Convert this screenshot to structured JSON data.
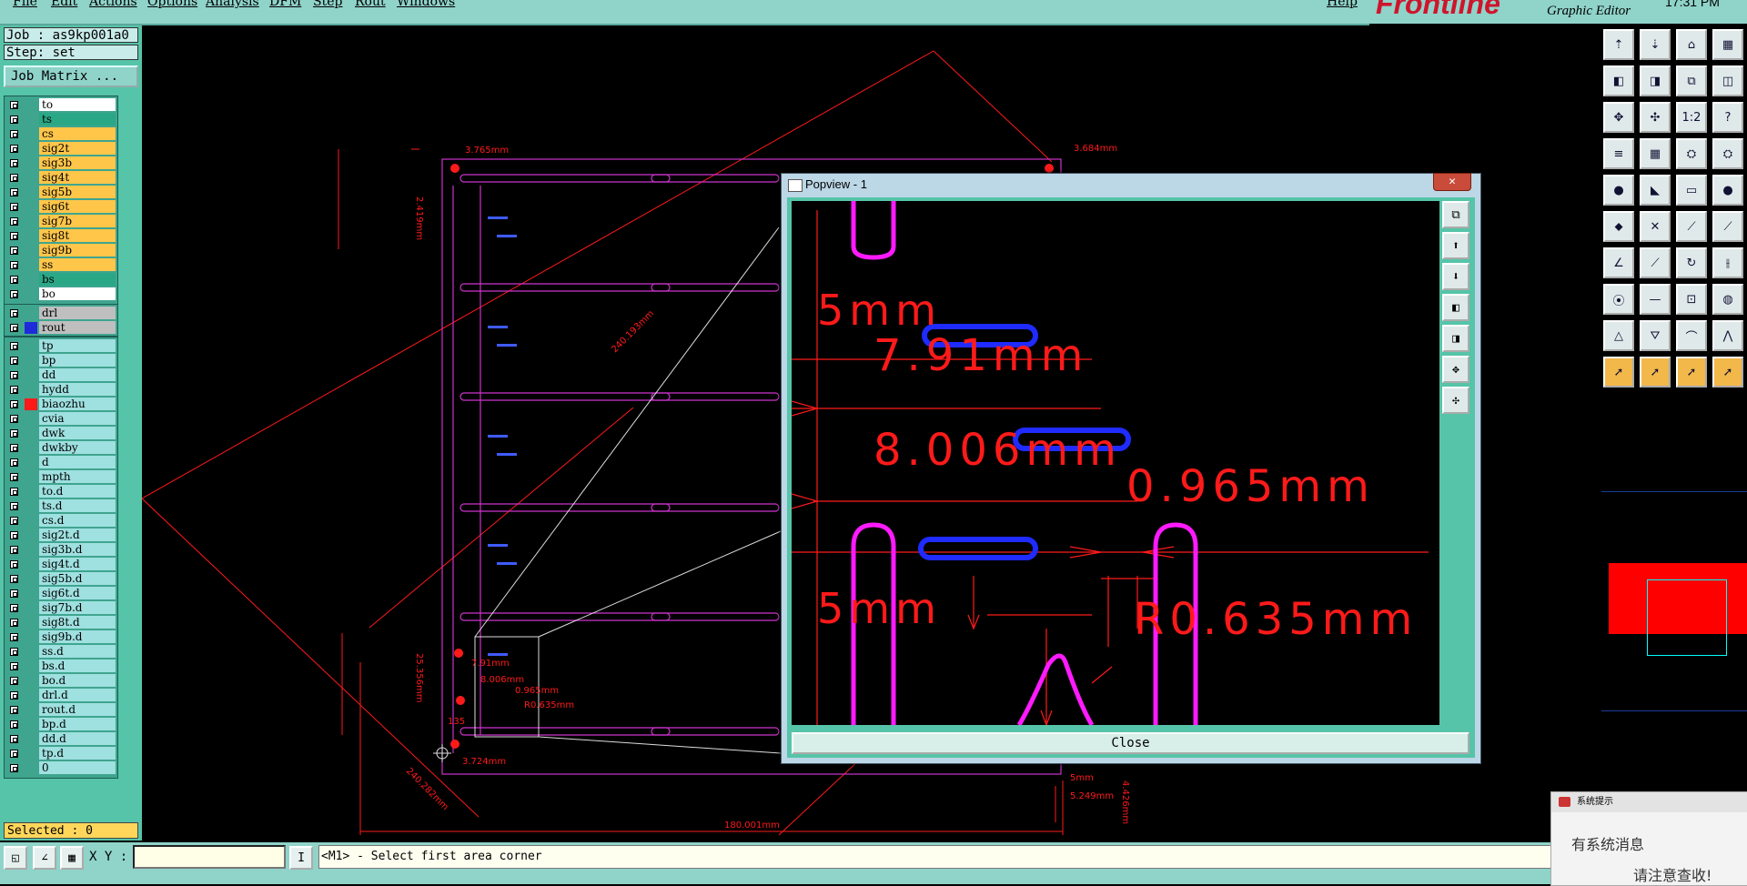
{
  "menu": {
    "items": [
      "File",
      "Edit",
      "Actions",
      "Options",
      "Analysis",
      "DFM",
      "Step",
      "Rout",
      "Windows"
    ],
    "help": "Help"
  },
  "brand": {
    "name": "Frontline",
    "subtitle": "Graphic Editor",
    "time": "17:31 PM"
  },
  "job": {
    "label": "Job : as9kp001a0",
    "step": "Step: set",
    "matrix_button": "Job Matrix ..."
  },
  "layers": {
    "group1": [
      {
        "name": "to",
        "color": "#ffffff"
      },
      {
        "name": "ts",
        "color": "#2aa886"
      },
      {
        "name": "cs",
        "color": "#ffc64a"
      },
      {
        "name": "sig2t",
        "color": "#ffc64a"
      },
      {
        "name": "sig3b",
        "color": "#ffc64a"
      },
      {
        "name": "sig4t",
        "color": "#ffc64a"
      },
      {
        "name": "sig5b",
        "color": "#ffc64a"
      },
      {
        "name": "sig6t",
        "color": "#ffc64a"
      },
      {
        "name": "sig7b",
        "color": "#ffc64a"
      },
      {
        "name": "sig8t",
        "color": "#ffc64a"
      },
      {
        "name": "sig9b",
        "color": "#ffc64a"
      },
      {
        "name": "ss",
        "color": "#ffc64a"
      },
      {
        "name": "bs",
        "color": "#2aa886"
      },
      {
        "name": "bo",
        "color": "#ffffff"
      }
    ],
    "group2": [
      {
        "name": "drl",
        "color": "#bfbfbf"
      },
      {
        "name": "rout",
        "color": "#bfbfbf",
        "swatch": "#1f2bd8"
      }
    ],
    "group3": [
      {
        "name": "tp"
      },
      {
        "name": "bp"
      },
      {
        "name": "dd"
      },
      {
        "name": "hydd"
      },
      {
        "name": "biaozhu",
        "swatch": "#ff1a1a",
        "mark": "■"
      },
      {
        "name": "cvia"
      },
      {
        "name": "dwk"
      },
      {
        "name": "dwkby"
      },
      {
        "name": "d"
      },
      {
        "name": "mpth"
      },
      {
        "name": "to.d",
        "mark": "✎"
      },
      {
        "name": "ts.d"
      },
      {
        "name": "cs.d"
      },
      {
        "name": "sig2t.d"
      },
      {
        "name": "sig3b.d"
      },
      {
        "name": "sig4t.d"
      },
      {
        "name": "sig5b.d"
      },
      {
        "name": "sig6t.d"
      },
      {
        "name": "sig7b.d"
      },
      {
        "name": "sig8t.d"
      },
      {
        "name": "sig9b.d"
      },
      {
        "name": "ss.d"
      },
      {
        "name": "bs.d"
      },
      {
        "name": "bo.d",
        "mark": "✎"
      },
      {
        "name": "drl.d"
      },
      {
        "name": "rout.d"
      },
      {
        "name": "bp.d"
      },
      {
        "name": "dd.d"
      },
      {
        "name": "tp.d"
      },
      {
        "name": "0"
      }
    ],
    "default_color": "#9fe0e0"
  },
  "selected": "Selected : 0",
  "canvas": {
    "dims": [
      "3.765mm",
      "3.684mm",
      "2.419mm",
      "240.193mm",
      "7.91mm",
      "8.006mm",
      "0.965mm",
      "25.356mm",
      "135",
      "3.724mm",
      "5mm",
      "5.249mm",
      "4.426mm",
      "180.001mm",
      "240.282mm",
      "R0.635mm"
    ]
  },
  "popview": {
    "title": "Popview - 1",
    "close_label": "Close",
    "dims": [
      "5mm",
      "7.91mm",
      "8.006mm",
      "0.965mm",
      "5mm",
      "R0.635mm"
    ]
  },
  "bottom": {
    "xy_label": "X Y :",
    "xy_value": "",
    "message": "<M1> - Select first area corner"
  },
  "status_line": "...",
  "notice": {
    "title": "系统提示",
    "line1": "有系统消息",
    "line2": "请注意查收!"
  },
  "toolbar_icons": [
    "step-up-icon",
    "step-down-icon",
    "home-icon",
    "grid-icon",
    "zoom-prev-icon",
    "zoom-next-icon",
    "pan-icon",
    "split-icon",
    "fit-icon",
    "fit-profile-icon",
    "scale-1-2-icon",
    "help-icon",
    "layers-icon",
    "snap-grid-icon",
    "route-icon",
    "route-edit-icon",
    "pad-icon",
    "measure-icon",
    "keyboard-icon",
    "circle-icon",
    "node-icon",
    "cross-icon",
    "line-point-icon",
    "point-line-icon",
    "angle-icon",
    "diagonal-icon",
    "arc-icon",
    "compare-icon",
    "clearance-icon",
    "minus-icon",
    "center-icon",
    "multi-circle-icon",
    "triangle-icon",
    "pyramid-icon",
    "arch-icon",
    "peak-icon",
    "select-icon",
    "select-edit-icon",
    "select-move-icon",
    "select-multi-icon"
  ],
  "colors": {
    "accent": "#56c4a8",
    "menu": "#8fd3c9",
    "dim_red": "#ff1a1a",
    "board_magenta": "#ff1aff",
    "slot_blue": "#1f2bff"
  }
}
